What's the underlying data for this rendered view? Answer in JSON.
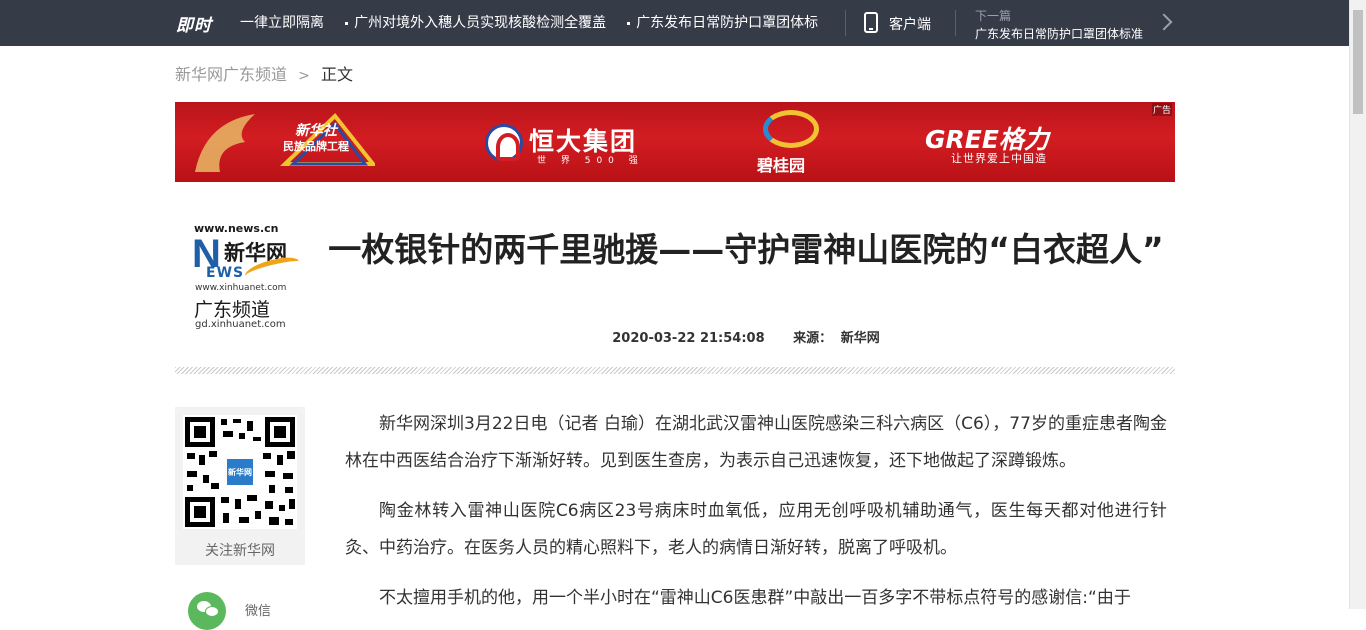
{
  "topbar": {
    "logo": "即时",
    "ticker": [
      "一律立即隔离",
      "广州对境外入穗人员实现核酸检测全覆盖",
      "广东发布日常防护口罩团体标准"
    ],
    "client_label": "客户端",
    "next_label": "下一篇",
    "next_title": "广东发布日常防护口罩团体标准"
  },
  "breadcrumb": {
    "channel": "新华网广东频道",
    "separator": ">",
    "current": "正文"
  },
  "banner": {
    "ad_tag": "广告",
    "xinhua_slogan_1": "新华社",
    "xinhua_slogan_2": "民族品牌工程",
    "hengda_name": "恒大集团",
    "hengda_sub": "世 界 500 强",
    "bgy_name": "碧桂园",
    "gree_name": "GREE格力",
    "gree_sub": "让世界爱上中国造"
  },
  "channel_logo": {
    "url": "www.news.cn",
    "n": "N",
    "xinhuawang": "新华网",
    "news": "EWS",
    "url2": "www.xinhuanet.com",
    "channel": "广东频道",
    "channel_url": "gd.xinhuanet.com"
  },
  "article": {
    "title": "一枚银针的两千里驰援——守护雷神山医院的“白衣超人”",
    "datetime": "2020-03-22 21:54:08",
    "source_label": "来源：",
    "source": "新华网",
    "paragraphs": [
      "新华网深圳3月22日电（记者 白瑜）在湖北武汉雷神山医院感染三科六病区（C6），77岁的重症患者陶金林在中西医结合治疗下渐渐好转。见到医生查房，为表示自己迅速恢复，还下地做起了深蹲锻炼。",
      "陶金林转入雷神山医院C6病区23号病床时血氧低，应用无创呼吸机辅助通气，医生每天都对他进行针灸、中药治疗。在医务人员的精心照料下，老人的病情日渐好转，脱离了呼吸机。",
      "不太擅用手机的他，用一个半小时在“雷神山C6医患群”中敲出一百多字不带标点符号的感谢信:“由于"
    ]
  },
  "share": {
    "qr_badge": "新华网",
    "qr_caption": "关注新华网",
    "wechat_label": "微信"
  },
  "colors": {
    "topbar_bg": "#363b48",
    "banner_red": "#d21d22",
    "xinhua_blue": "#1f5fa8"
  }
}
